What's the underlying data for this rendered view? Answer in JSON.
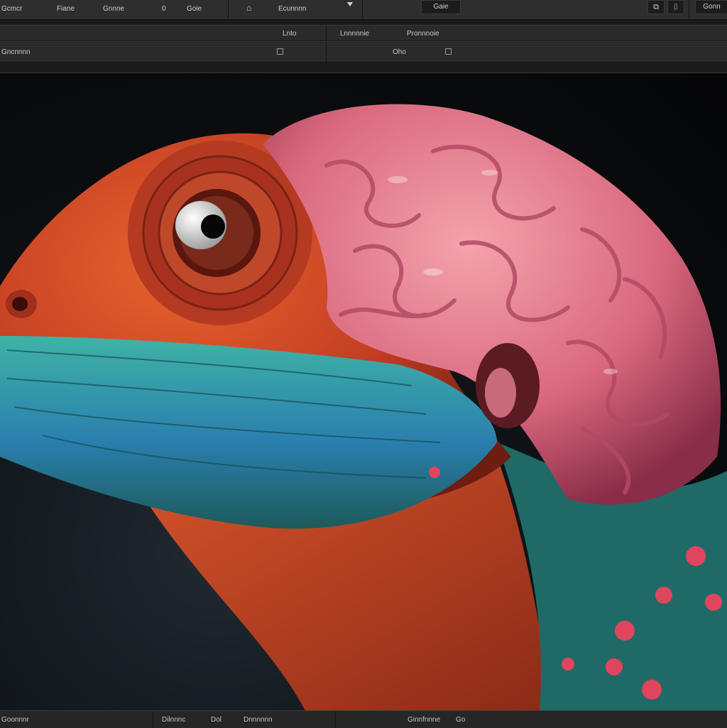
{
  "menubar": {
    "items": [
      "Gcmcr",
      "Fiane",
      "Gnnne",
      "0",
      "Goie",
      "Ecunnnn"
    ],
    "button_center": "Gaie",
    "button_right": "Gonn"
  },
  "toolbar": {
    "row1": [
      "Lnto",
      "Lnnnnnie",
      "Pronnnoie"
    ],
    "row2": [
      "Gncnnnn",
      "Oho"
    ]
  },
  "statusbar": {
    "items": [
      "Goonnnr",
      "Dilnnnc",
      "Dol",
      "Dnnnnnn",
      "Ginnfnnne",
      "Go"
    ]
  },
  "colors": {
    "accent_skin": "#d4502a",
    "accent_brain": "#e0788a",
    "accent_scales": "#2f9a9a"
  }
}
